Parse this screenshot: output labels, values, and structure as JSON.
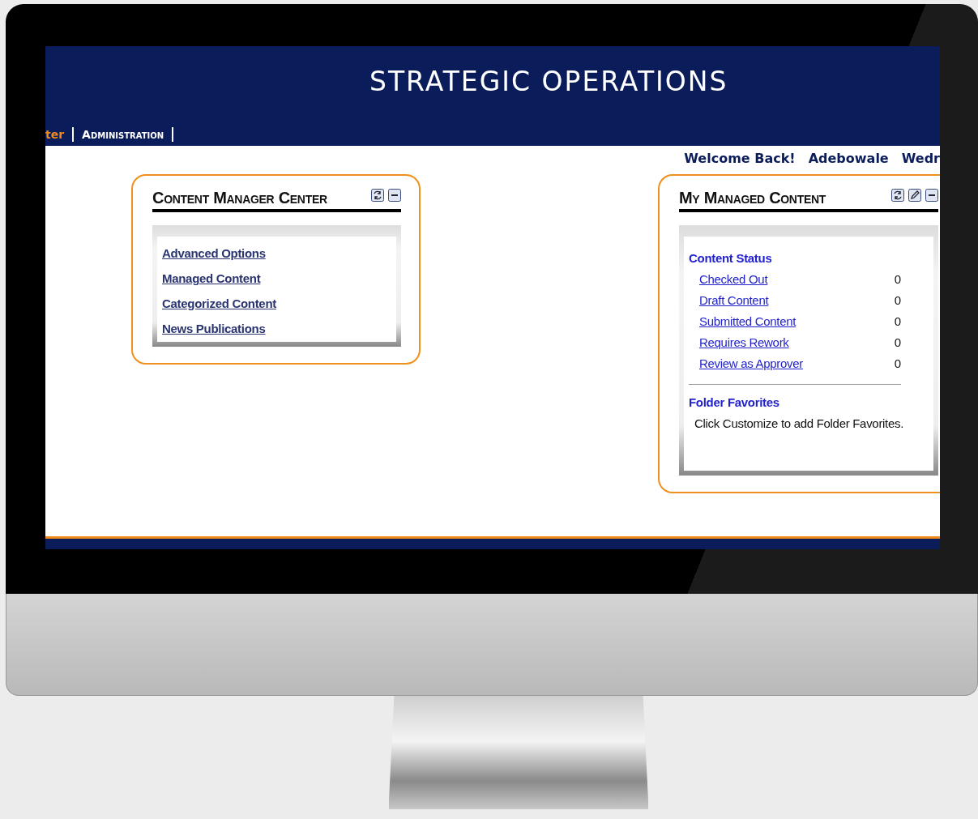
{
  "header": {
    "title": "STRATEGIC OPERATIONS"
  },
  "nav": [
    {
      "label": "ter",
      "selected": true
    },
    {
      "label": "Administration",
      "selected": false
    }
  ],
  "welcome": [
    "Welcome Back!",
    "Adebowale",
    "Wedr"
  ],
  "left_card": {
    "title": "Content Manager Center",
    "tools": [
      {
        "kind": "refresh"
      },
      {
        "kind": "minimize"
      }
    ],
    "links": [
      "Advanced Options",
      "Managed Content",
      "Categorized Content",
      "News Publications"
    ]
  },
  "right_card": {
    "title": "My Managed Content",
    "tools": [
      {
        "kind": "refresh"
      },
      {
        "kind": "edit"
      },
      {
        "kind": "minimize"
      }
    ],
    "status_heading": "Content Status",
    "status_rows": [
      {
        "label": "Checked Out",
        "count": "0"
      },
      {
        "label": "Draft Content",
        "count": "0"
      },
      {
        "label": "Submitted Content",
        "count": "0"
      },
      {
        "label": "Requires Rework",
        "count": "0"
      },
      {
        "label": "Review as Approver",
        "count": "0"
      }
    ],
    "favorites_heading": "Folder Favorites",
    "favorites_note": "Click Customize to add Folder Favorites."
  }
}
